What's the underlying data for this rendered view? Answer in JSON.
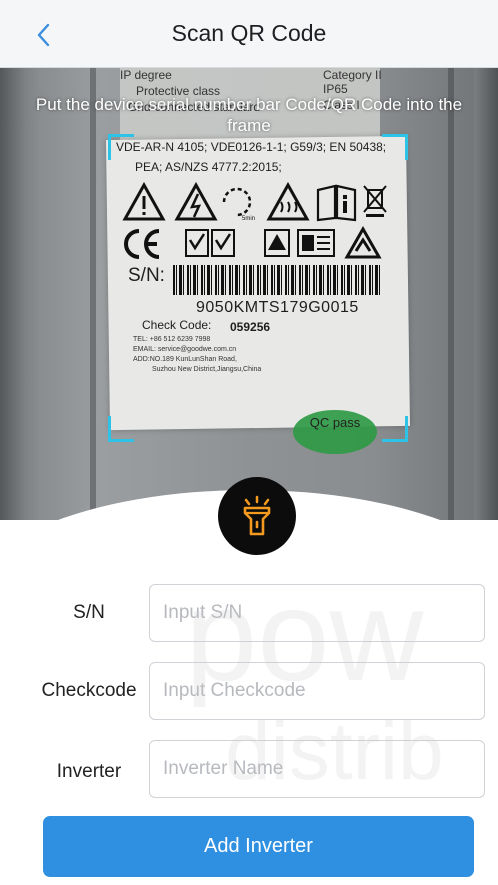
{
  "header": {
    "title": "Scan QR Code",
    "back_icon": "chevron-left-icon"
  },
  "scanner": {
    "instruction": "Put the device serial number bar Code/QR Code into the frame",
    "torch_icon": "flashlight-icon"
  },
  "label_sticker": {
    "row1_left": "IP degree",
    "row1_right": "Category II",
    "row2_left": "Protective class",
    "row2_right": "IP65",
    "row3_left": "Grid-connected standard",
    "row3_right": "Class I",
    "standards": "VDE-AR-N 4105; VDE0126-1-1; G59/3; EN 50438;",
    "standards2": "PEA;  AS/NZS 4777.2:2015;",
    "sn_label": "S/N:",
    "serial_number": "9050KMTS179G0015",
    "check_code_label": "Check Code:",
    "check_code_value": "059256",
    "contact_tel": "TEL: +86 512 6239 7998",
    "contact_email": "EMAIL: service@goodwe.com.cn",
    "contact_address": "ADD:NO.189 KunLunShan Road,",
    "contact_address2": "Suzhou New District,Jiangsu,China",
    "qc_stamp": "QC pass"
  },
  "form": {
    "sn": {
      "label": "S/N",
      "value": "",
      "placeholder": "Input S/N"
    },
    "checkcode": {
      "label": "Checkcode",
      "value": "",
      "placeholder": "Input Checkcode"
    },
    "inverter": {
      "label": "Inverter",
      "value": "",
      "placeholder": "Inverter Name"
    },
    "submit_label": "Add Inverter"
  },
  "watermark": {
    "line1": "pow",
    "line2": "distrib"
  },
  "colors": {
    "accent_blue": "#2f8fe0",
    "scan_frame": "#2ec3e6",
    "torch_orange": "#f39a1f",
    "qc_green": "#2f9a46"
  }
}
